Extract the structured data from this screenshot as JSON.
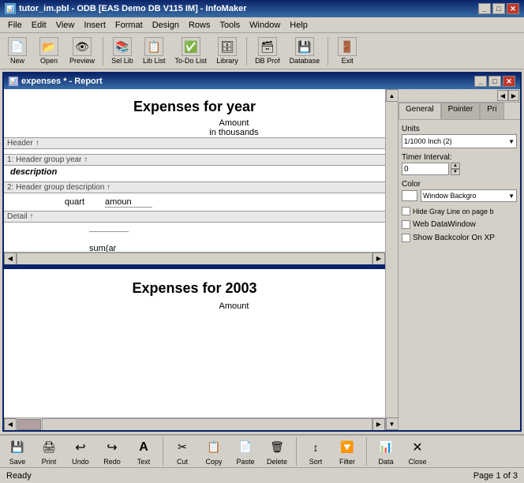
{
  "app": {
    "title": "tutor_im.pbl - ODB [EAS Demo DB V115 IM] - InfoMaker",
    "title_icon": "📄"
  },
  "menu": {
    "items": [
      "File",
      "Edit",
      "View",
      "Insert",
      "Format",
      "Design",
      "Rows",
      "Tools",
      "Window",
      "Help"
    ]
  },
  "toolbar": {
    "buttons": [
      {
        "name": "new",
        "label": "New",
        "icon": "📄"
      },
      {
        "name": "open",
        "label": "Open",
        "icon": "📂"
      },
      {
        "name": "preview",
        "label": "Preview",
        "icon": "👁"
      },
      {
        "name": "sel-lib",
        "label": "Sel Lib",
        "icon": "📚"
      },
      {
        "name": "lib-list",
        "label": "Lib List",
        "icon": "📋"
      },
      {
        "name": "to-do-list",
        "label": "To-Do List",
        "icon": "✅"
      },
      {
        "name": "library",
        "label": "Library",
        "icon": "🗄"
      },
      {
        "name": "db-prof",
        "label": "DB Prof",
        "icon": "🗃"
      },
      {
        "name": "database",
        "label": "Database",
        "icon": "💾"
      },
      {
        "name": "exit",
        "label": "Exit",
        "icon": "🚪"
      }
    ]
  },
  "document": {
    "title": "expenses * - Report",
    "title_icon": "📊"
  },
  "properties": {
    "tabs": [
      "General",
      "Pointer",
      "Pri"
    ],
    "active_tab": "General",
    "units_label": "Units",
    "units_value": "1/1000 Inch (2)",
    "timer_label": "Timer Interval:",
    "timer_value": "0",
    "color_label": "Color",
    "color_value": "Window Backgro",
    "hide_gray_label": "Hide Gray Line on page b",
    "web_dw_label": "Web DataWindow",
    "show_backcolor_label": "Show Backcolor On XP"
  },
  "report": {
    "top_title": "Expenses for  year",
    "amount_label": "Amount",
    "in_thousands": "in thousands",
    "header_section": "Header ↑",
    "header_group1": "1: Header group year ↑",
    "description_label": "description",
    "header_group2": "2: Header group description ↑",
    "detail_cols": {
      "col1": "quart",
      "col2": "amoun"
    },
    "detail_section": "Detail ↑",
    "sum_formula": "sum(ar",
    "preview_title": "Expenses for  2003",
    "preview_amount": "Amount"
  },
  "bottom_toolbar": {
    "buttons": [
      {
        "name": "save",
        "label": "Save",
        "icon": "💾"
      },
      {
        "name": "print",
        "label": "Print",
        "icon": "🖨"
      },
      {
        "name": "undo",
        "label": "Undo",
        "icon": "↩"
      },
      {
        "name": "redo",
        "label": "Redo",
        "icon": "↪"
      },
      {
        "name": "text",
        "label": "Text",
        "icon": "T"
      },
      {
        "name": "cut",
        "label": "Cut",
        "icon": "✂"
      },
      {
        "name": "copy",
        "label": "Copy",
        "icon": "📋"
      },
      {
        "name": "paste",
        "label": "Paste",
        "icon": "📄"
      },
      {
        "name": "delete",
        "label": "Delete",
        "icon": "🗑"
      },
      {
        "name": "sort",
        "label": "Sort",
        "icon": "↕"
      },
      {
        "name": "filter",
        "label": "Filter",
        "icon": "🔽"
      },
      {
        "name": "data",
        "label": "Data",
        "icon": "📊"
      },
      {
        "name": "close",
        "label": "Close",
        "icon": "✕"
      }
    ]
  },
  "status": {
    "ready": "Ready",
    "page": "Page 1 of 3"
  }
}
